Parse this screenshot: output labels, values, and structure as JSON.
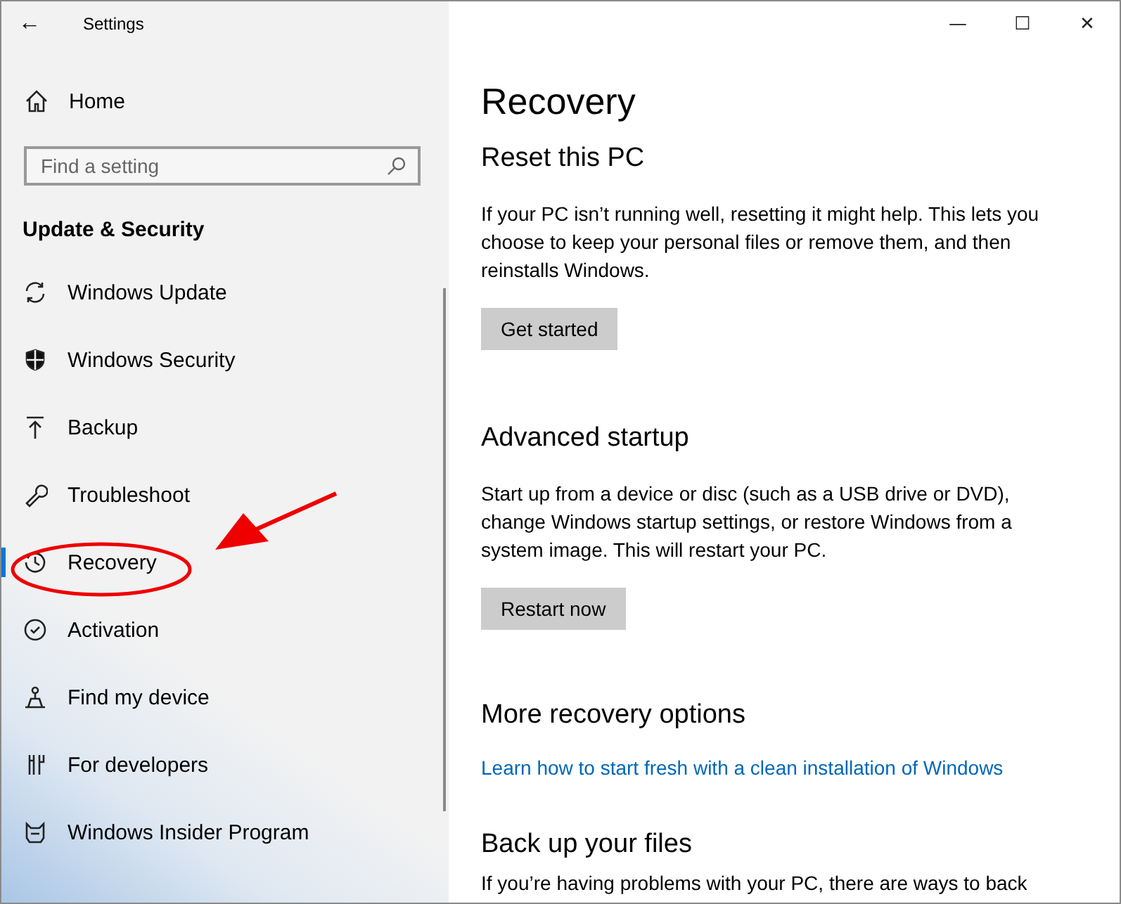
{
  "window": {
    "title": "Settings",
    "back": "←",
    "controls": [
      "—",
      "☐",
      "✕"
    ]
  },
  "sidebar": {
    "home": "Home",
    "search": {
      "placeholder": "Find a setting"
    },
    "section": "Update & Security",
    "items": [
      {
        "label": "Windows Update",
        "selected": false
      },
      {
        "label": "Windows Security",
        "selected": false
      },
      {
        "label": "Backup",
        "selected": false
      },
      {
        "label": "Troubleshoot",
        "selected": false
      },
      {
        "label": "Recovery",
        "selected": true
      },
      {
        "label": "Activation",
        "selected": false
      },
      {
        "label": "Find my device",
        "selected": false
      },
      {
        "label": "For developers",
        "selected": false
      },
      {
        "label": "Windows Insider Program",
        "selected": false
      }
    ]
  },
  "content": {
    "title": "Recovery",
    "sections": [
      {
        "heading": "Reset this PC",
        "text": "If your PC isn’t running well, resetting it might help. This lets you choose to keep your personal files or remove them, and then reinstalls Windows.",
        "button": "Get started"
      },
      {
        "heading": "Advanced startup",
        "text": "Start up from a device or disc (such as a USB drive or DVD), change Windows startup settings, or restore Windows from a system image. This will restart your PC.",
        "button": "Restart now"
      },
      {
        "heading": "More recovery options",
        "link": "Learn how to start fresh with a clean installation of Windows"
      },
      {
        "heading": "Back up your files",
        "text": "If you’re having problems with your PC, there are ways to back"
      }
    ]
  }
}
